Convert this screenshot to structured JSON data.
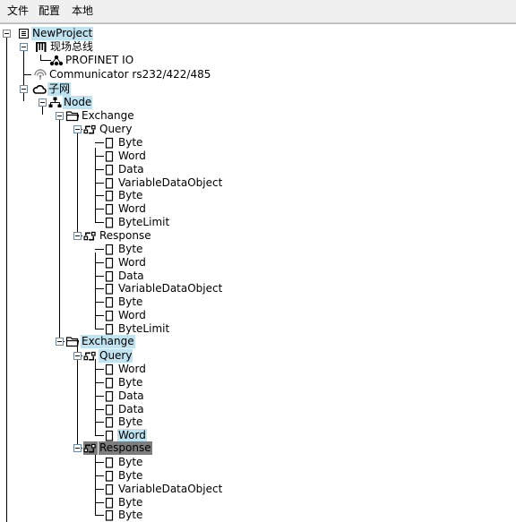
{
  "menu": [
    "文件",
    "配置",
    "本地"
  ],
  "tree": [
    {
      "icon": "project-icon",
      "label": "NewProject",
      "state": "hl"
    },
    {
      "icon": "fieldbus-icon",
      "label": "现场总线"
    },
    {
      "icon": "network-node-icon",
      "label": "PROFINET IO"
    },
    {
      "icon": "communicator-icon",
      "label": "Communicator rs232/422/485"
    },
    {
      "icon": "cloud-icon",
      "label": "子网",
      "state": "hl"
    },
    {
      "icon": "hierarchy-icon",
      "label": "Node",
      "state": "hl"
    },
    {
      "icon": "folder-icon",
      "label": "Exchange"
    },
    {
      "icon": "exchange-icon",
      "label": "Query"
    },
    {
      "icon": "field-icon",
      "label": "Byte"
    },
    {
      "icon": "field-icon",
      "label": "Word"
    },
    {
      "icon": "field-icon",
      "label": "Data"
    },
    {
      "icon": "field-icon",
      "label": "VariableDataObject"
    },
    {
      "icon": "field-icon",
      "label": "Byte"
    },
    {
      "icon": "field-icon",
      "label": "Word"
    },
    {
      "icon": "field-icon",
      "label": "ByteLimit"
    },
    {
      "icon": "exchange-icon",
      "label": "Response"
    },
    {
      "icon": "field-icon",
      "label": "Byte"
    },
    {
      "icon": "field-icon",
      "label": "Word"
    },
    {
      "icon": "field-icon",
      "label": "Data"
    },
    {
      "icon": "field-icon",
      "label": "VariableDataObject"
    },
    {
      "icon": "field-icon",
      "label": "Byte"
    },
    {
      "icon": "field-icon",
      "label": "Word"
    },
    {
      "icon": "field-icon",
      "label": "ByteLimit"
    },
    {
      "icon": "folder-icon",
      "label": "Exchange",
      "state": "hl"
    },
    {
      "icon": "exchange-icon",
      "label": "Query",
      "state": "hl"
    },
    {
      "icon": "field-icon",
      "label": "Word"
    },
    {
      "icon": "field-icon",
      "label": "Byte"
    },
    {
      "icon": "field-icon",
      "label": "Data"
    },
    {
      "icon": "field-icon",
      "label": "Data"
    },
    {
      "icon": "field-icon",
      "label": "Byte"
    },
    {
      "icon": "field-icon",
      "label": "Word",
      "state": "hl"
    },
    {
      "icon": "exchange-icon",
      "label": "Response",
      "state": "gray"
    },
    {
      "icon": "field-icon",
      "label": "Byte"
    },
    {
      "icon": "field-icon",
      "label": "Byte"
    },
    {
      "icon": "field-icon",
      "label": "VariableDataObject"
    },
    {
      "icon": "field-icon",
      "label": "Byte"
    },
    {
      "icon": "field-icon",
      "label": "Byte"
    }
  ],
  "colors": {
    "selection": "#bfe3f1",
    "inactive_selection": "#7d7d7d",
    "menubar": "#f0f0f0"
  }
}
